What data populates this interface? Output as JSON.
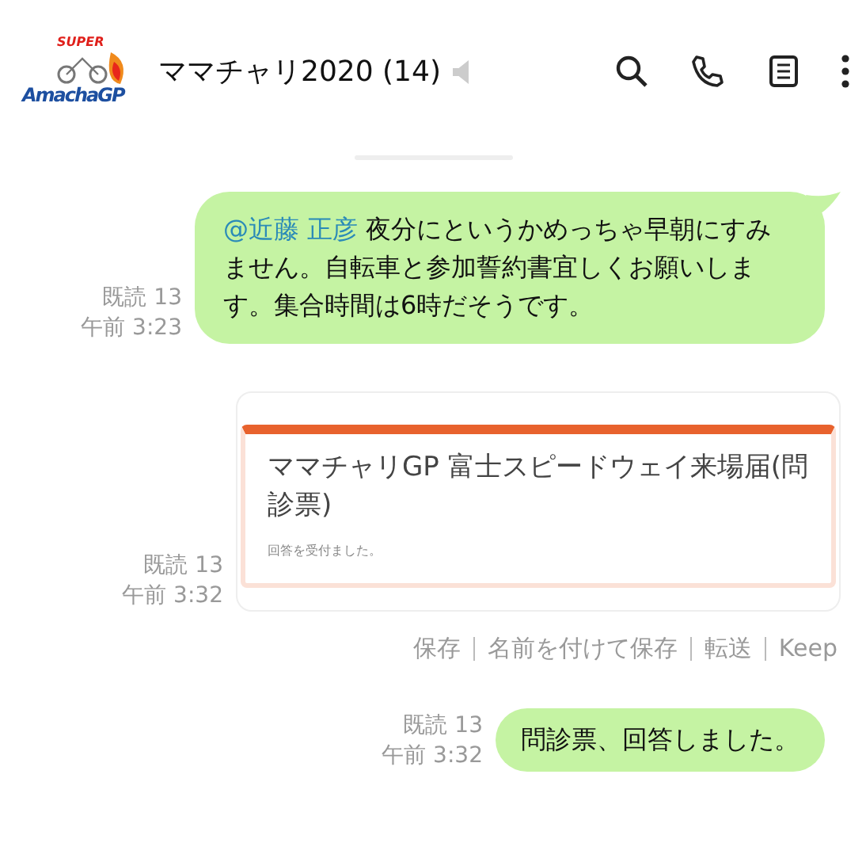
{
  "header": {
    "logo": {
      "top": "SUPER",
      "main": "AmachaGP"
    },
    "title": "ママチャリ2020 (14)",
    "muted": true
  },
  "messages": [
    {
      "kind": "text",
      "read": "既読 13",
      "time": "午前 3:23",
      "mention": "@近藤 正彦",
      "text": "夜分にというかめっちゃ早朝にすみません。自転車と参加誓約書宜しくお願いします。集合時間は6時だそうです。"
    },
    {
      "kind": "link",
      "read": "既読 13",
      "time": "午前 3:32",
      "card": {
        "title": "ママチャリGP 富士スピードウェイ来場届(問診票)",
        "note": "回答を受付ました。"
      },
      "actions": [
        "保存",
        "名前を付けて保存",
        "転送",
        "Keep"
      ]
    },
    {
      "kind": "text",
      "read": "既読 13",
      "time": "午前 3:32",
      "text": "問診票、回答しました。"
    }
  ]
}
